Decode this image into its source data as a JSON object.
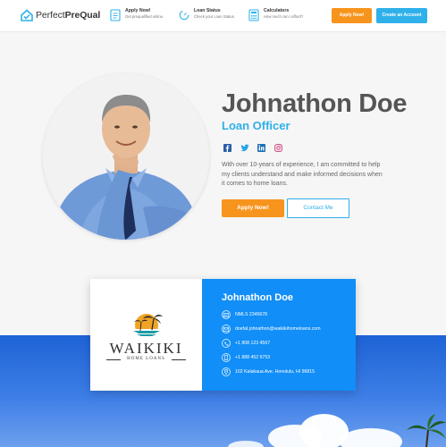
{
  "nav": {
    "logo_part1": "Perfect",
    "logo_part2": "PreQual",
    "items": [
      {
        "title": "Apply Now!",
        "subtitle": "Get prequalified online."
      },
      {
        "title": "Loan Status",
        "subtitle": "Check your Loan Status."
      },
      {
        "title": "Calculators",
        "subtitle": "How much can I afford?"
      }
    ],
    "apply_button": "Apply Now!",
    "account_button": "Create an Account"
  },
  "profile": {
    "name": "Johnathon Doe",
    "title": "Loan Officer",
    "bio": "With over 10-years of experience, I am committed to help my clients understand and make informed decisions when it comes to home loans.",
    "apply_button": "Apply Now!",
    "contact_button": "Contact Me",
    "socials": [
      "facebook-icon",
      "twitter-icon",
      "linkedin-icon",
      "instagram-icon"
    ]
  },
  "card": {
    "brand_big": "WAIKIKI",
    "brand_small": "HOME LOANS",
    "name": "Johnathon Doe",
    "nmls": "NMLS  2345678",
    "email": "doefal.johnathon@waikikihomeloans.com",
    "phone1": "+1 808 123 4567",
    "phone2": "+1 888 452 9753",
    "address": "102 Kalakaua Ave. Honolulu, HI 96815"
  },
  "colors": {
    "accent_blue": "#2fb0ea",
    "orange": "#f7941d",
    "card_blue": "#118ef7"
  }
}
